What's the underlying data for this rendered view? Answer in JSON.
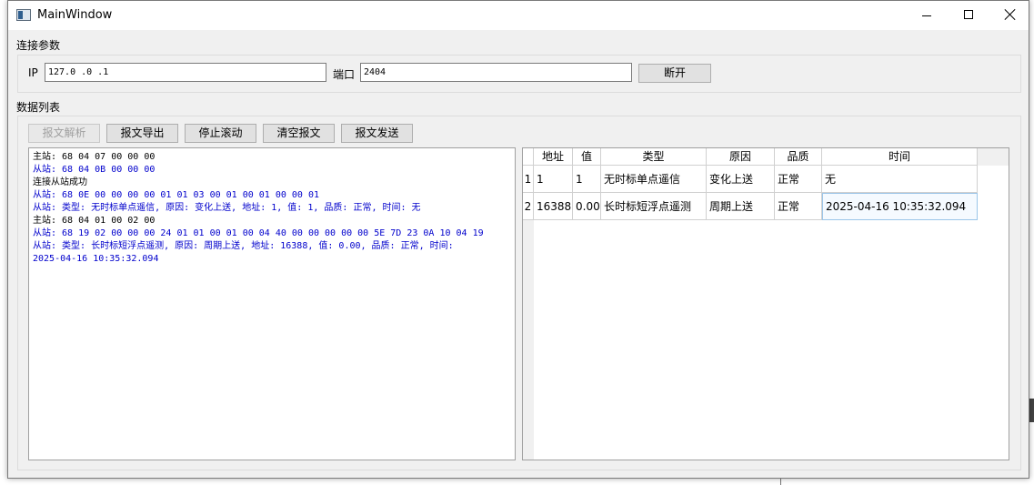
{
  "window": {
    "title": "MainWindow"
  },
  "connection": {
    "group_label": "连接参数",
    "ip_label": "IP",
    "ip_value": "127.0  .0  .1",
    "port_label": "端口",
    "port_value": "2404",
    "disconnect_label": "断开"
  },
  "data_list": {
    "group_label": "数据列表",
    "toolbar": {
      "parse": "报文解析",
      "export": "报文导出",
      "stop_scroll": "停止滚动",
      "clear": "清空报文",
      "send": "报文发送"
    },
    "log": [
      {
        "text": "主站: 68 04 07 00 00 00",
        "kind": "master"
      },
      {
        "text": "从站: 68 04 0B 00 00 00",
        "kind": "slave"
      },
      {
        "text": "连接从站成功",
        "kind": "master"
      },
      {
        "text": "从站: 68 0E 00 00 00 00 01 01 03 00 01 00 01 00 00 01",
        "kind": "slave"
      },
      {
        "text": "从站: 类型: 无时标单点遥信, 原因: 变化上送, 地址: 1, 值: 1, 品质: 正常, 时间: 无",
        "kind": "slave"
      },
      {
        "text": "主站: 68 04 01 00 02 00",
        "kind": "master"
      },
      {
        "text": "从站: 68 19 02 00 00 00 24 01 01 00 01 00 04 40 00 00 00 00 00 5E 7D 23 0A 10 04 19",
        "kind": "slave"
      },
      {
        "text": "从站: 类型: 长时标短浮点遥测, 原因: 周期上送, 地址: 16388, 值: 0.00, 品质: 正常, 时间:",
        "kind": "slave"
      },
      {
        "text": "2025-04-16 10:35:32.094",
        "kind": "slave"
      }
    ],
    "table": {
      "headers": [
        "地址",
        "值",
        "类型",
        "原因",
        "品质",
        "时间"
      ],
      "row_numbers": [
        "1",
        "2"
      ],
      "rows": [
        [
          "1",
          "1",
          "无时标单点遥信",
          "变化上送",
          "正常",
          "无"
        ],
        [
          "16388",
          "0.00",
          "长时标短浮点遥测",
          "周期上送",
          "正常",
          "2025-04-16 10:35:32.094"
        ]
      ]
    }
  }
}
